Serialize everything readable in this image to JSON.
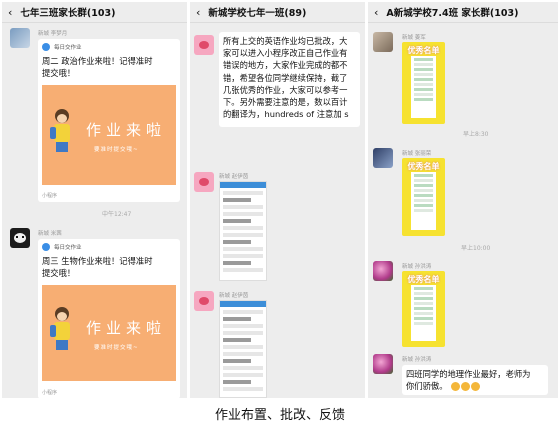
{
  "panels": [
    {
      "title": "七年三班家长群(103)",
      "messages": [
        {
          "sender": "新城 李梦月",
          "app": "每日交作业",
          "text": [
            "周二 政治作业来啦！记得准时",
            "提交哦！"
          ],
          "banner_title": "作业来啦",
          "banner_sub": "要准时提交哦~",
          "footer": "小程序"
        },
        {
          "sender": "新城 米茜",
          "app": "每日交作业",
          "text": [
            "周三 生物作业来啦！记得准时",
            "提交哦！"
          ],
          "banner_title": "作业来啦",
          "banner_sub": "要准时提交哦~",
          "footer": "小程序"
        }
      ],
      "time": "中午12:47"
    },
    {
      "title": "新城学校七年一班(89)",
      "bubble_lines": [
        "所有上交的英语作业均已批改，大",
        "家可以进入小程序改正自己作业有",
        "错误的地方，大家作业完成的都不",
        "错，希望各位同学继续保持，截了",
        "几张优秀的作业，大家可以参考一",
        "下。另外需要注意的是，数以百计",
        "的翻译为，hundreds of 注意加 s"
      ],
      "senders": [
        "新城 赵伊茵",
        "新城 赵伊茵"
      ]
    },
    {
      "title": "A新城学校7.4班 家长群(103)",
      "senders": [
        "新城 姜军",
        "新城 张丽荣",
        "新城 孙洪涛",
        "新城 孙洪涛"
      ],
      "poster_title": "优秀名单",
      "times": [
        "早上8:30",
        "早上10:00"
      ],
      "last_message": [
        "四班同学的地理作业最好，老师为",
        "你们骄傲。"
      ]
    }
  ],
  "caption": "作业布置、批改、反馈",
  "colors": {
    "banner": "#f7ae73",
    "poster": "#f6e230",
    "chat_bg": "#ededed"
  }
}
